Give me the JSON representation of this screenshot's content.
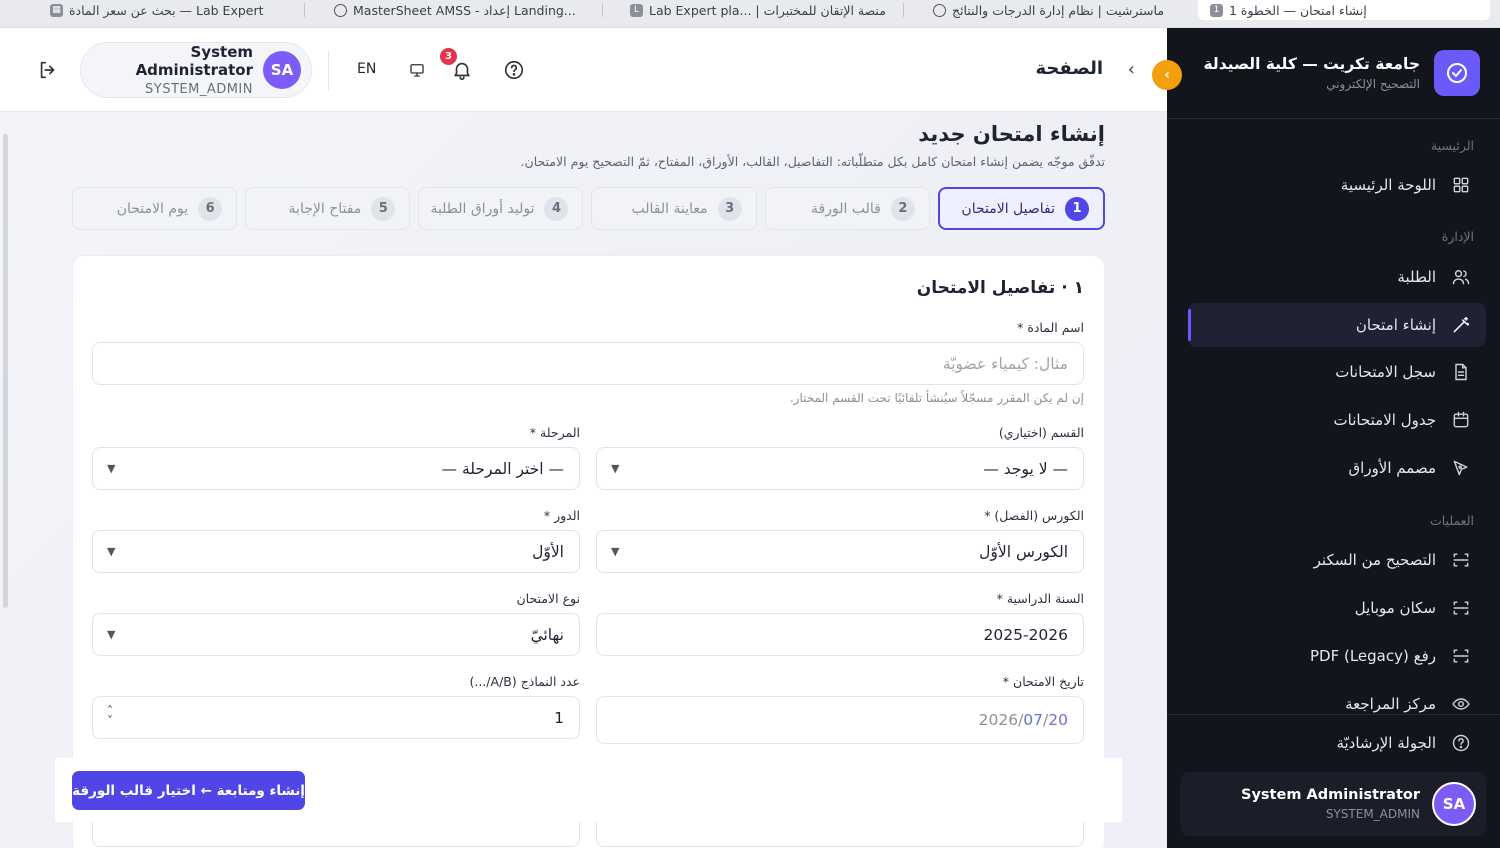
{
  "browser_tabs": [
    {
      "title": "بحث عن سعر المادة — Lab Expert"
    },
    {
      "title": "MasterSheet AMSS - إعداد Landing..."
    },
    {
      "title": "Lab Expert pla... | منصة الإتقان للمختبرات"
    },
    {
      "title": "ماسترشيت | نظام إدارة الدرجات والنتائج"
    },
    {
      "title": "إنشاء امتحان — الخطوة 1"
    }
  ],
  "sidebar": {
    "brand_title": "جامعة تكريت — كلية الصيدلة",
    "brand_subtitle": "التصحيح الإلكتروني",
    "sections": [
      {
        "label": "الرئيسية"
      },
      {
        "label": "الإدارة"
      },
      {
        "label": "العمليات"
      }
    ],
    "items": [
      {
        "label": "اللوحة الرئيسية",
        "icon": "grid-icon"
      },
      {
        "label": "الطلبة",
        "icon": "users-icon"
      },
      {
        "label": "إنشاء امتحان",
        "icon": "magic-wand-icon",
        "active": true
      },
      {
        "label": "سجل الامتحانات",
        "icon": "document-icon"
      },
      {
        "label": "جدول الامتحانات",
        "icon": "calendar-icon"
      },
      {
        "label": "مصمم الأوراق",
        "icon": "design-icon"
      },
      {
        "label": "التصحيح من السكنر",
        "icon": "scan-icon"
      },
      {
        "label": "سكان موبايل",
        "icon": "scan-icon"
      },
      {
        "label": "رفع PDF (Legacy)",
        "icon": "scan-icon"
      },
      {
        "label": "مركز المراجعة",
        "icon": "eye-icon"
      },
      {
        "label": "الجولة الإرشاديّة",
        "icon": "help-icon"
      }
    ],
    "user": {
      "name": "System Administrator",
      "role": "SYSTEM_ADMIN",
      "initials": "SA"
    }
  },
  "topbar": {
    "page_title": "الصفحة",
    "language": "EN",
    "notifications_count": "3",
    "user": {
      "name": "System Administrator",
      "role": "SYSTEM_ADMIN",
      "initials": "SA"
    }
  },
  "main": {
    "title": "إنشاء امتحان جديد",
    "subtitle": "تدفّق موجّه يضمن إنشاء امتحان كامل بكل متطلّباته: التفاصيل، القالب، الأوراق، المفتاح، ثمّ التصحيح يوم الامتحان.",
    "steps": [
      {
        "num": "1",
        "label": "تفاصيل الامتحان"
      },
      {
        "num": "2",
        "label": "قالب الورقة"
      },
      {
        "num": "3",
        "label": "معاينة القالب"
      },
      {
        "num": "4",
        "label": "توليد أوراق الطلبة"
      },
      {
        "num": "5",
        "label": "مفتاح الإجابة"
      },
      {
        "num": "6",
        "label": "يوم الامتحان"
      }
    ],
    "section_title": "١ · تفاصيل الامتحان",
    "fields": {
      "subject_label": "اسم المادة *",
      "subject_placeholder": "مثال: كيمياء عضويّة",
      "subject_hint": "إن لم يكن المقرر مسجّلاً سيُنشأ تلقائيًا تحت القسم المختار.",
      "department_label": "القسم (اختياري)",
      "department_value": "— لا يوجد —",
      "stage_label": "المرحلة *",
      "stage_value": "— اختر المرحلة —",
      "course_label": "الكورس (الفصل) *",
      "course_value": "الكورس الأوّل",
      "round_label": "الدور *",
      "round_value": "الأوّل",
      "year_label": "السنة الدراسية *",
      "year_value": "2025-2026",
      "exam_type_label": "نوع الامتحان",
      "exam_type_value": "نهائيّ",
      "date_label": "تاريخ الامتحان *",
      "date_year": "2026",
      "date_month": "07",
      "date_day": "20",
      "variants_label": "عدد النماذج (A/B/...)",
      "variants_value": "1"
    },
    "submit_label": "إنشاء ومتابعة ← اختيار قالب الورقة"
  },
  "colors": {
    "accent": "#4f46e5",
    "sidebar_bg": "#13151d",
    "collapse": "#f59e0b",
    "badge": "#e5334b"
  }
}
